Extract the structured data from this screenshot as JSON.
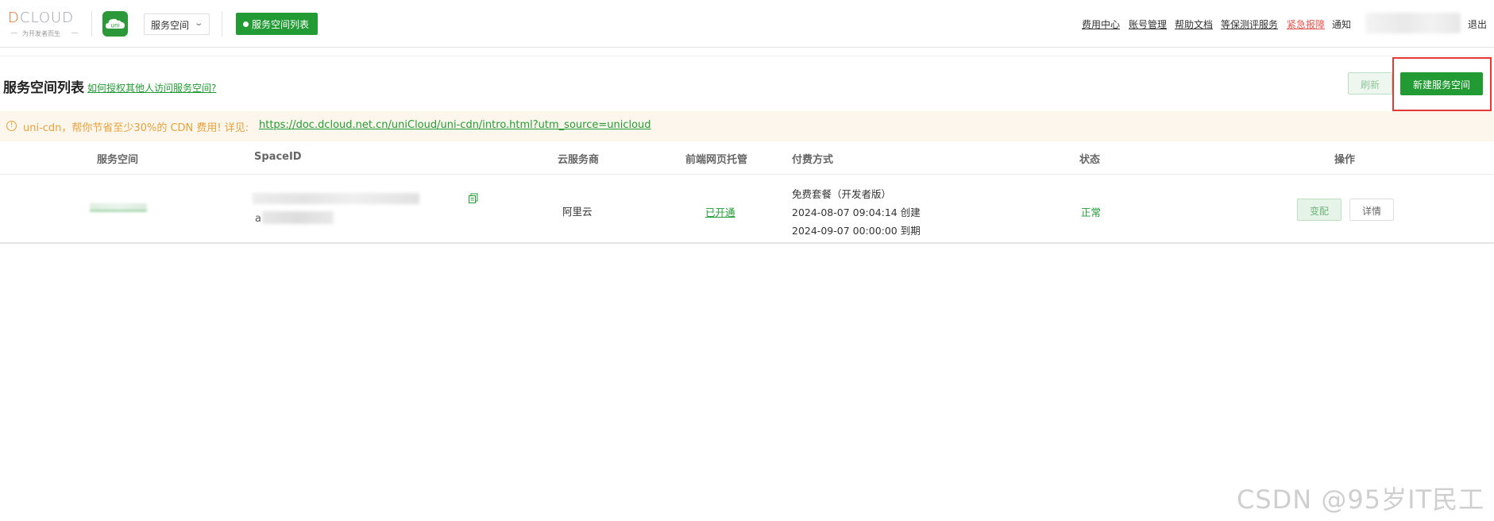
{
  "header": {
    "logo_text": "CLOUD",
    "logo_letter": "D",
    "logo_slogan": "为开发者而生",
    "uni_icon_label": "uni",
    "space_select": {
      "value": "服务空间",
      "icon": "chevron-down-icon"
    },
    "nav_pill": "服务空间列表",
    "links": {
      "billing": "费用中心",
      "account": "账号管理",
      "docs": "帮助文档",
      "security_eval": "等保测评服务",
      "urgent": "紧急报障",
      "notify": "通知"
    },
    "logout": "退出"
  },
  "page": {
    "title": "服务空间列表",
    "help_link": "如何授权其他人访问服务空间?",
    "refresh_label": "刷新",
    "create_label": "新建服务空间"
  },
  "notice": {
    "text": "uni-cdn，帮你节省至少30%的 CDN 费用! 详见:",
    "link": "https://doc.dcloud.net.cn/uniCloud/uni-cdn/intro.html?utm_source=unicloud",
    "icon": "warning-circle-icon"
  },
  "table": {
    "columns": [
      "服务空间",
      "SpaceID",
      "云服务商",
      "前端网页托管",
      "付费方式",
      "状态",
      "操作"
    ],
    "rows": [
      {
        "space_id_prefix": "a",
        "provider": "阿里云",
        "hosting": "已开通",
        "plan": "免费套餐（开发者版）",
        "created": "2024-08-07 09:04:14 创建",
        "expires": "2024-09-07 00:00:00 到期",
        "status": "正常",
        "action_change": "变配",
        "action_detail": "详情"
      }
    ]
  },
  "watermark": "CSDN @95岁IT民工",
  "colors": {
    "brand_green": "#239b35",
    "warning_orange": "#e6a23c",
    "urgent_red": "#e4564f",
    "highlight_red": "#e53935"
  }
}
